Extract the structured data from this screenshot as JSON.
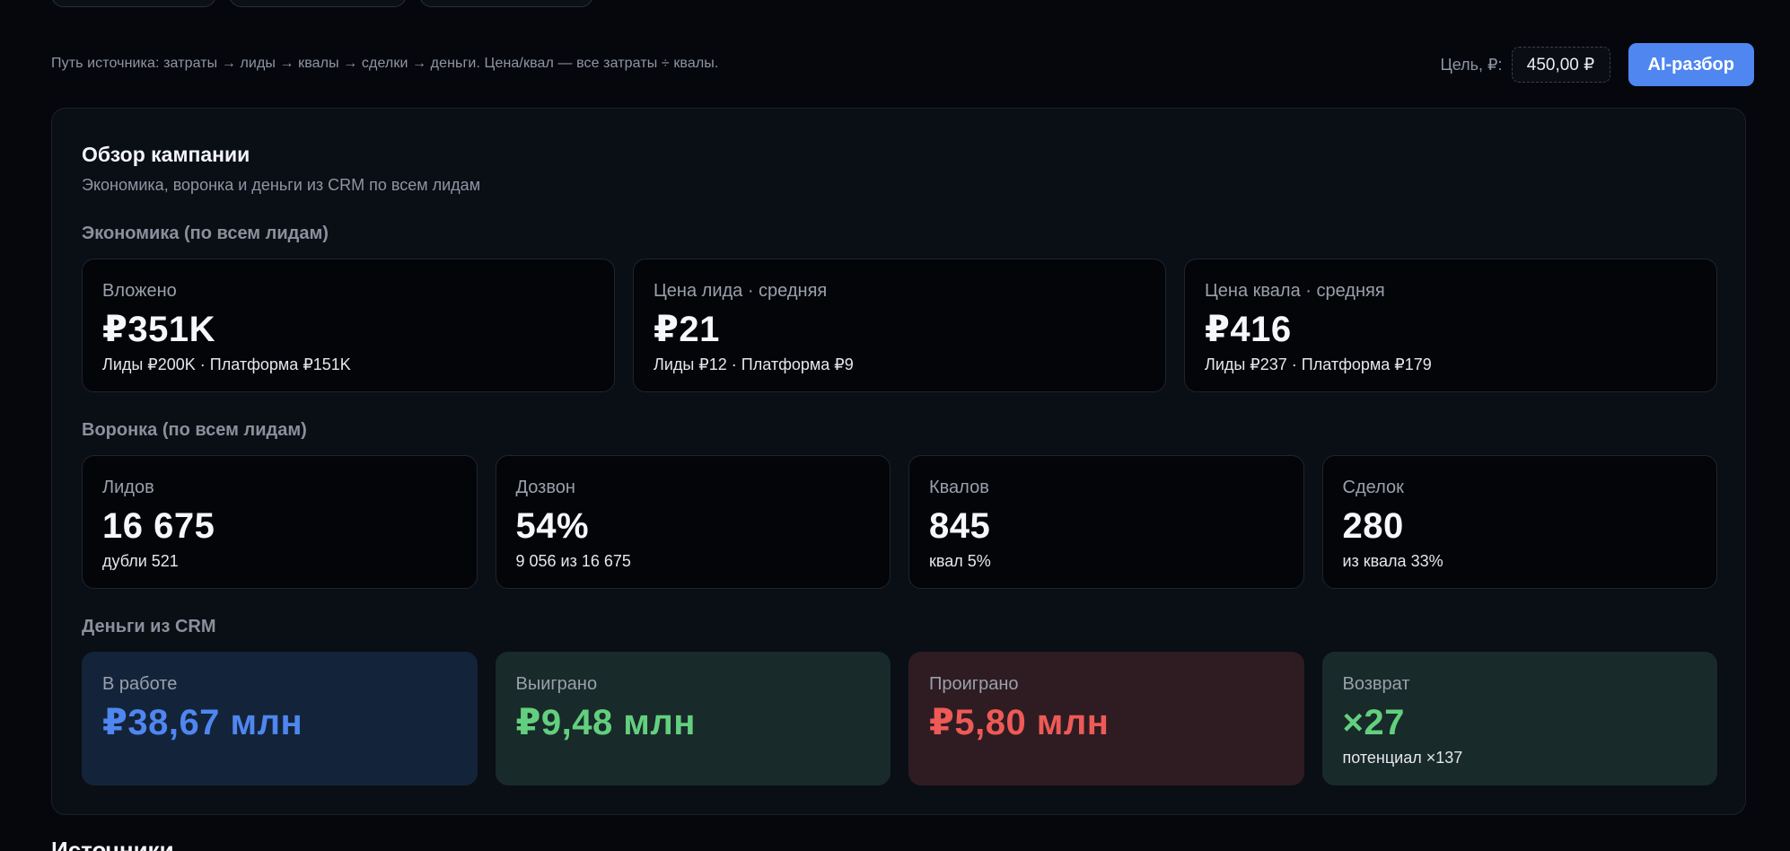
{
  "header": {
    "hint": "Путь источника: затраты → лиды → квалы → сделки → деньги. Цена/квал — все затраты ÷ квалы.",
    "goal_label": "Цель, ₽:",
    "goal_value": "450,00 ₽",
    "ai_button": "AI-разбор"
  },
  "panel": {
    "title": "Обзор кампании",
    "subtitle": "Экономика, воронка и деньги из CRM по всем лидам",
    "economy": {
      "label": "Экономика (по всем лидам)",
      "cards": [
        {
          "label": "Вложено",
          "value": "₽351K",
          "sub": "Лиды ₽200K · Платформа ₽151K"
        },
        {
          "label": "Цена лида · средняя",
          "value": "₽21",
          "sub": "Лиды ₽12 · Платформа ₽9"
        },
        {
          "label": "Цена квала · средняя",
          "value": "₽416",
          "sub": "Лиды ₽237 · Платформа ₽179"
        }
      ]
    },
    "funnel": {
      "label": "Воронка (по всем лидам)",
      "cards": [
        {
          "label": "Лидов",
          "value": "16 675",
          "sub": "дубли 521"
        },
        {
          "label": "Дозвон",
          "value": "54%",
          "sub": "9 056 из 16 675"
        },
        {
          "label": "Квалов",
          "value": "845",
          "sub": "квал 5%"
        },
        {
          "label": "Сделок",
          "value": "280",
          "sub": "из квала 33%"
        }
      ]
    },
    "money": {
      "label": "Деньги из CRM",
      "cards": [
        {
          "label": "В работе",
          "value": "₽38,67 млн",
          "sub": ""
        },
        {
          "label": "Выиграно",
          "value": "₽9,48 млн",
          "sub": ""
        },
        {
          "label": "Проиграно",
          "value": "₽5,80 млн",
          "sub": ""
        },
        {
          "label": "Возврат",
          "value": "×27",
          "sub": "потенциал ×137"
        }
      ]
    }
  },
  "next_section": {
    "title": "Источники"
  },
  "colors": {
    "accent_blue": "#4f86f0",
    "won_green": "#63cf7e",
    "lost_red": "#ee5a56"
  }
}
